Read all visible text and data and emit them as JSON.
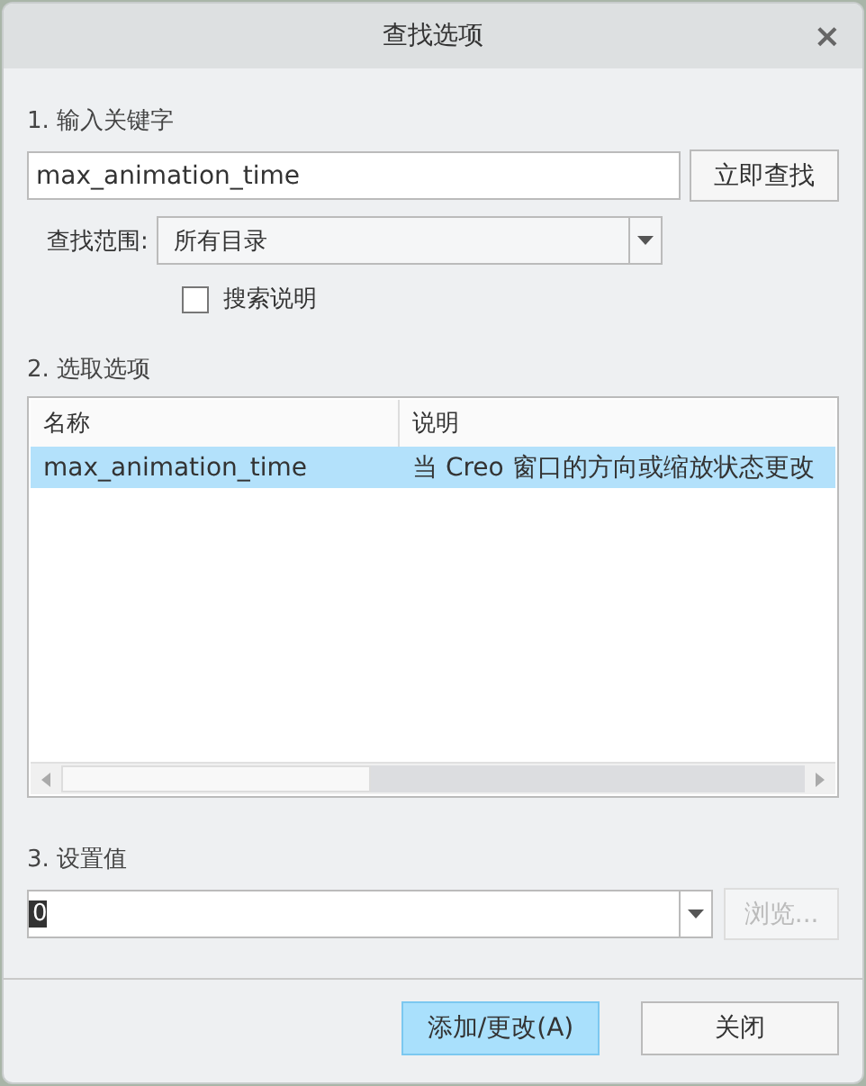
{
  "window": {
    "title": "查找选项",
    "close": "×"
  },
  "keyword_section": {
    "label": "1. 输入关键字",
    "input_value": "max_animation_time",
    "search_button": "立即查找",
    "scope_label": "查找范围:",
    "scope_value": "所有目录",
    "search_description": {
      "label": "搜索说明",
      "checked": false
    }
  },
  "options_section": {
    "label": "2. 选取选项",
    "table": {
      "columns": [
        "名称",
        "说明"
      ],
      "rows": [
        {
          "cells": [
            "max_animation_time",
            "当 Creo 窗口的方向或缩放状态更改"
          ],
          "selected": true
        }
      ]
    }
  },
  "value_section": {
    "label": "3. 设置值",
    "value": "0",
    "browse_button": {
      "label": "浏览...",
      "disabled": true
    }
  },
  "buttons": [
    {
      "label": "添加/更改(A)",
      "focused": true
    },
    {
      "label": "关闭",
      "focused": false
    }
  ]
}
